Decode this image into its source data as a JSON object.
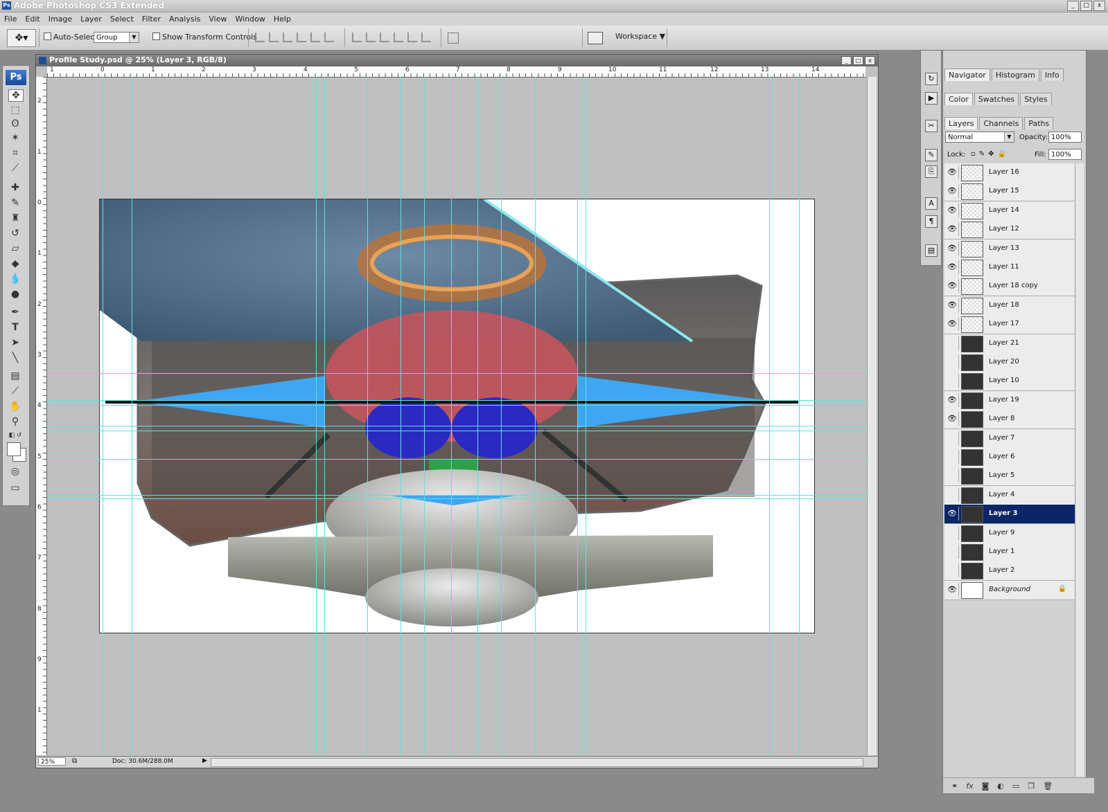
{
  "app": {
    "title": "Adobe Photoshop CS3 Extended",
    "logo": "Ps"
  },
  "window_controls": [
    "_",
    "□",
    "x"
  ],
  "menu": [
    "File",
    "Edit",
    "Image",
    "Layer",
    "Select",
    "Filter",
    "Analysis",
    "View",
    "Window",
    "Help"
  ],
  "options": {
    "auto_select_label": "Auto-Select:",
    "auto_select_value": "Group",
    "transform_label": "Show Transform Controls",
    "workspace_label": "Workspace"
  },
  "document": {
    "title": "Profile Study.psd @ 25% (Layer 3, RGB/8)",
    "zoom": "25%",
    "doc_size": "Doc: 30.6M/288.0M",
    "hruler_labels": [
      "1",
      "0",
      "1",
      "2",
      "3",
      "4",
      "5",
      "6",
      "7",
      "8",
      "9",
      "10",
      "11",
      "12",
      "13",
      "14"
    ],
    "vruler_labels": [
      "2",
      "1",
      "0",
      "1",
      "2",
      "3",
      "4",
      "5",
      "6",
      "7",
      "8",
      "9",
      "1"
    ]
  },
  "panels": {
    "group1_tabs": [
      "Navigator",
      "Histogram",
      "Info"
    ],
    "group2_tabs": [
      "Color",
      "Swatches",
      "Styles"
    ],
    "group3_tabs": [
      "Layers",
      "Channels",
      "Paths"
    ],
    "blend_mode": "Normal",
    "opacity_label": "Opacity:",
    "opacity_value": "100%",
    "lock_label": "Lock:",
    "fill_label": "Fill:",
    "fill_value": "100%",
    "footer_icons": [
      "link-icon",
      "fx-icon",
      "mask-icon",
      "adjustment-icon",
      "folder-icon",
      "new-layer-icon",
      "trash-icon"
    ]
  },
  "layers": [
    {
      "name": "Layer 16",
      "visible": true
    },
    {
      "name": "Layer 15",
      "visible": true
    },
    {
      "name": "Layer 14",
      "visible": true
    },
    {
      "name": "Layer 12",
      "visible": true
    },
    {
      "name": "Layer 13",
      "visible": true
    },
    {
      "name": "Layer 11",
      "visible": true
    },
    {
      "name": "Layer 18 copy",
      "visible": true
    },
    {
      "name": "Layer 18",
      "visible": true
    },
    {
      "name": "Layer 17",
      "visible": true
    },
    {
      "name": "Layer 21",
      "visible": false
    },
    {
      "name": "Layer 20",
      "visible": false
    },
    {
      "name": "Layer 10",
      "visible": false
    },
    {
      "name": "Layer 19",
      "visible": true
    },
    {
      "name": "Layer 8",
      "visible": true
    },
    {
      "name": "Layer 7",
      "visible": false
    },
    {
      "name": "Layer 6",
      "visible": false
    },
    {
      "name": "Layer 5",
      "visible": false
    },
    {
      "name": "Layer 4",
      "visible": false
    },
    {
      "name": "Layer 3",
      "visible": true,
      "selected": true
    },
    {
      "name": "Layer 9",
      "visible": false
    },
    {
      "name": "Layer 1",
      "visible": false
    },
    {
      "name": "Layer 2",
      "visible": false
    },
    {
      "name": "Background",
      "visible": true,
      "locked": true
    }
  ],
  "colors": {
    "guide": "#5fe0e0",
    "selection": "#0b2566",
    "blue_shape": "#3ea6f2"
  }
}
